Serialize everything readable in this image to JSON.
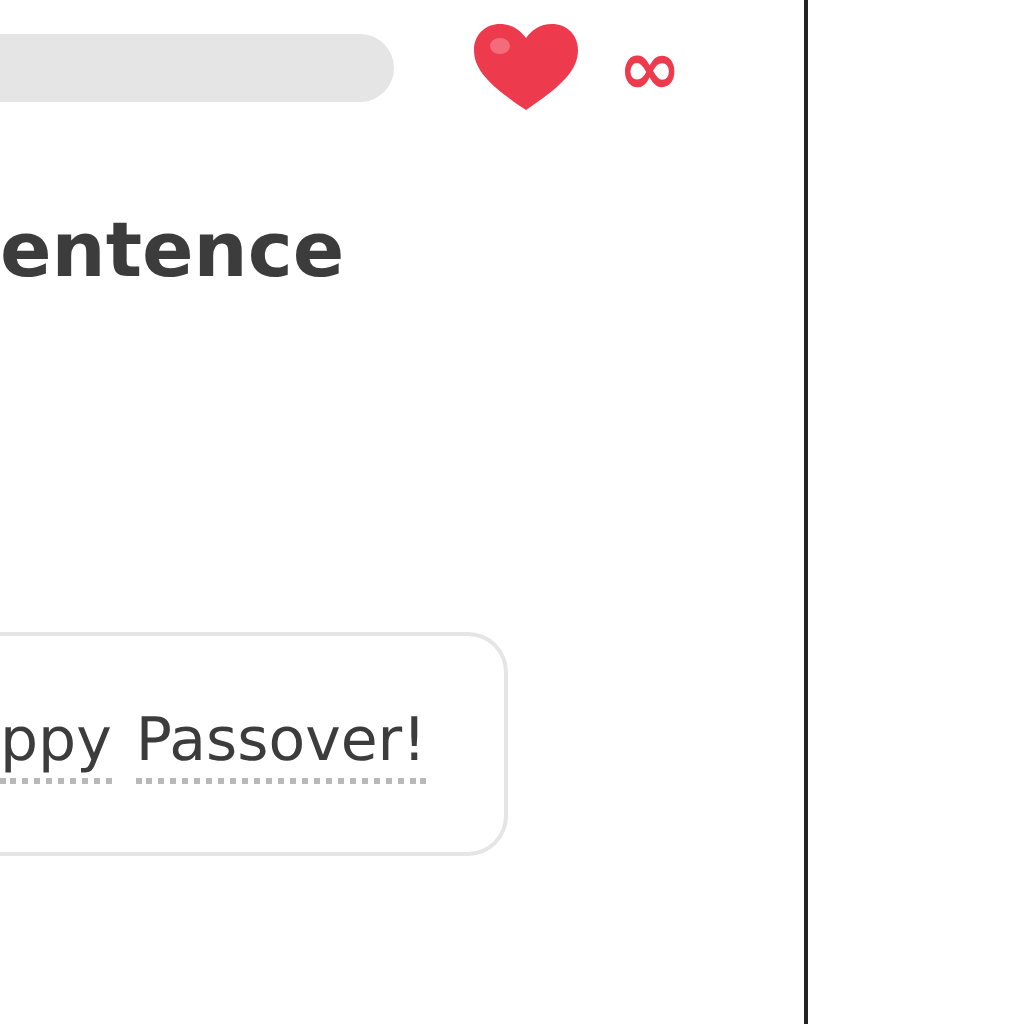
{
  "header": {
    "hearts": "∞"
  },
  "title": "entence",
  "sentence": {
    "words": [
      "ppy",
      "Passover!"
    ]
  }
}
